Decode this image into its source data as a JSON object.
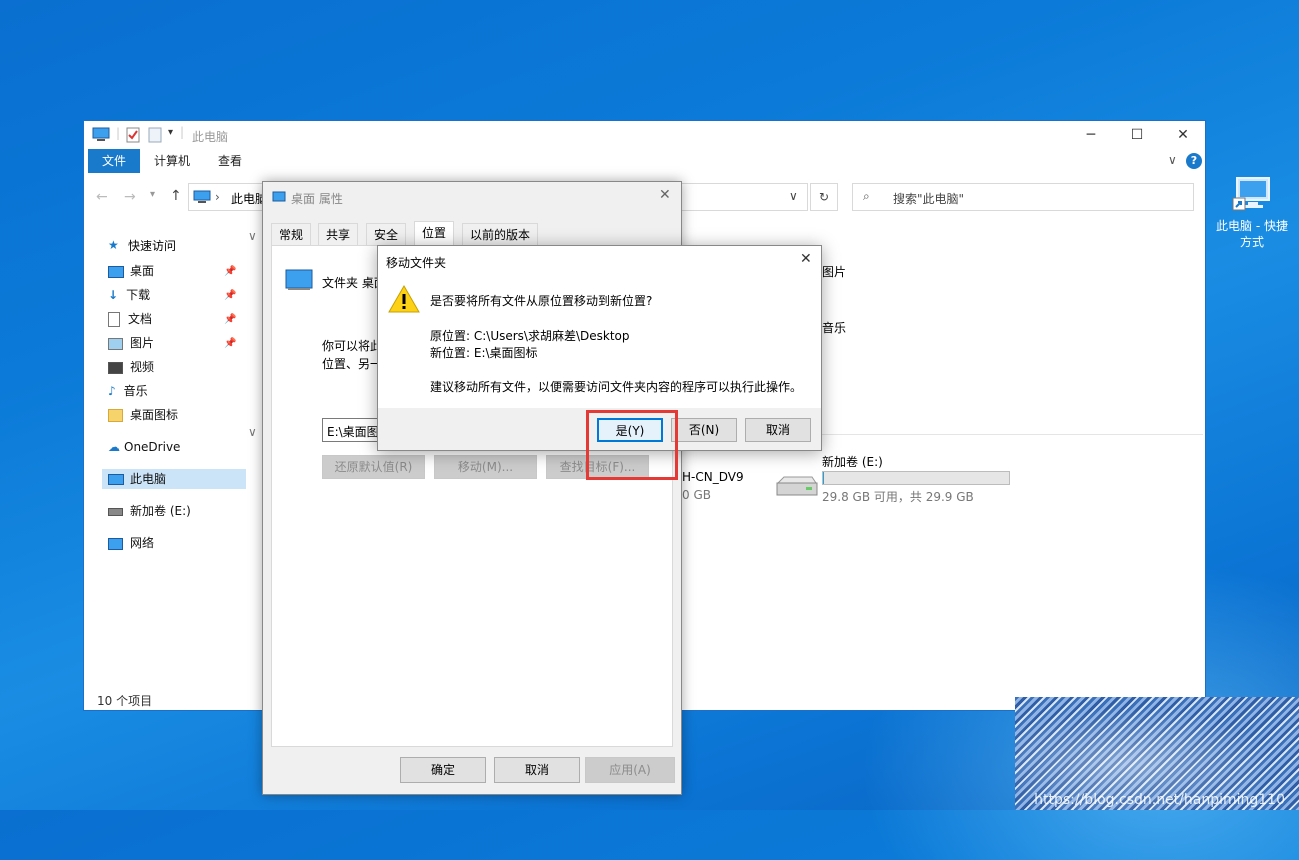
{
  "desktop": {
    "shortcut_label_line1": "此电脑 - 快捷",
    "shortcut_label_line2": "方式",
    "watermark": "https://blog.csdn.net/hanpiming110"
  },
  "explorer": {
    "title": "此电脑",
    "ribbon_tabs": [
      "文件",
      "计算机",
      "查看"
    ],
    "breadcrumb": "此电脑",
    "search_placeholder": "搜索\"此电脑\"",
    "nav": {
      "quick_access": "快速访问",
      "items": [
        {
          "label": "桌面",
          "pinned": true
        },
        {
          "label": "下载",
          "pinned": true
        },
        {
          "label": "文档",
          "pinned": true
        },
        {
          "label": "图片",
          "pinned": true
        },
        {
          "label": "视频",
          "pinned": false
        },
        {
          "label": "音乐",
          "pinned": false
        },
        {
          "label": "桌面图标",
          "pinned": false
        }
      ],
      "onedrive": "OneDrive",
      "this_pc": "此电脑",
      "new_volume": "新加卷 (E:)",
      "network": "网络"
    },
    "content": {
      "folder_pictures": "图片",
      "folder_music": "音乐",
      "drive_partial_name": "H-CN_DV9",
      "drive_partial_size": "0 GB",
      "drive_e_name": "新加卷 (E:)",
      "drive_e_space": "29.8 GB 可用，共 29.9 GB",
      "drive_e_usage": 0.003
    },
    "status": "10 个项目"
  },
  "properties": {
    "title": "桌面 属性",
    "tabs": [
      "常规",
      "共享",
      "安全",
      "位置",
      "以前的版本"
    ],
    "active_tab": "位置",
    "folder_label": "文件夹 桌面",
    "desc_line1": "你可以将此",
    "desc_line2": "位置、另一",
    "path_value": "E:\\桌面图标",
    "btn_restore": "还原默认值(R)",
    "btn_move": "移动(M)...",
    "btn_find": "查找目标(F)...",
    "btn_ok": "确定",
    "btn_cancel": "取消",
    "btn_apply": "应用(A)"
  },
  "msgbox": {
    "title": "移动文件夹",
    "question": "是否要将所有文件从原位置移动到新位置?",
    "orig_location": "原位置: C:\\Users\\求胡麻差\\Desktop",
    "new_location": "新位置: E:\\桌面图标",
    "advice": "建议移动所有文件，以便需要访问文件夹内容的程序可以执行此操作。",
    "btn_yes": "是(Y)",
    "btn_no": "否(N)",
    "btn_cancel": "取消"
  }
}
